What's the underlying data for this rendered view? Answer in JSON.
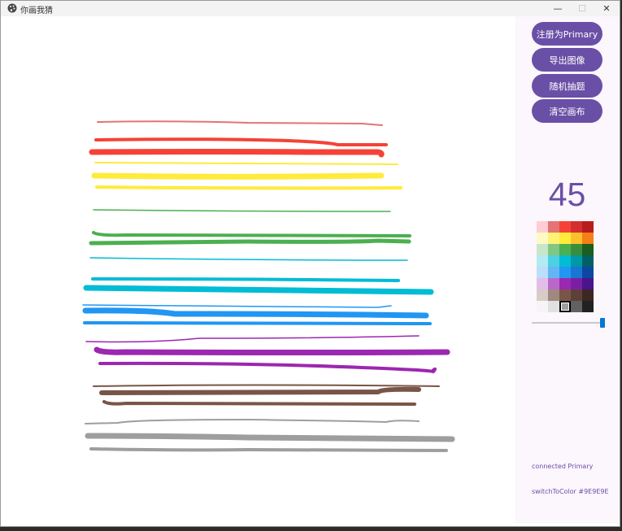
{
  "window": {
    "title": "你画我猜",
    "controls": [
      "—",
      "☐",
      "✕"
    ]
  },
  "actions": [
    {
      "label": "注册为Primary"
    },
    {
      "label": "导出图像"
    },
    {
      "label": "随机抽题"
    },
    {
      "label": "清空画布"
    }
  ],
  "brush": {
    "size": "45",
    "slider_fraction": 1.0,
    "selected_color": "#9E9E9E"
  },
  "palette": [
    [
      "#FFCDD2",
      "#E57373",
      "#F44336",
      "#D32F2F",
      "#B71C1C"
    ],
    [
      "#FFF9C4",
      "#FFF176",
      "#FFEB3B",
      "#FBC02D",
      "#F57F17"
    ],
    [
      "#C8E6C9",
      "#81C784",
      "#4CAF50",
      "#388E3C",
      "#1B5E20"
    ],
    [
      "#B2EBF2",
      "#4DD0E1",
      "#00BCD4",
      "#0097A7",
      "#006064"
    ],
    [
      "#BBDEFB",
      "#64B5F6",
      "#2196F3",
      "#1976D2",
      "#0D47A1"
    ],
    [
      "#E1BEE7",
      "#BA68C8",
      "#9C27B0",
      "#7B1FA2",
      "#4A148C"
    ],
    [
      "#D7CCC8",
      "#A1887F",
      "#795548",
      "#5D4037",
      "#3E2723"
    ],
    [
      "#F5F5F5",
      "#E0E0E0",
      "#9E9E9E",
      "#616161",
      "#212121"
    ]
  ],
  "status": {
    "connection": "connected   Primary",
    "last_event": "switchToColor #9E9E9E"
  },
  "strokes": [
    {
      "color": "#E57373",
      "width": 2
    },
    {
      "color": "#F44336",
      "width": 4
    },
    {
      "color": "#F44336",
      "width": 7
    },
    {
      "color": "#FFEB3B",
      "width": 2
    },
    {
      "color": "#FFEB3B",
      "width": 7
    },
    {
      "color": "#FFEB3B",
      "width": 4
    },
    {
      "color": "#4CAF50",
      "width": 1.5
    },
    {
      "color": "#4CAF50",
      "width": 4
    },
    {
      "color": "#4CAF50",
      "width": 5
    },
    {
      "color": "#00BCD4",
      "width": 1.5
    },
    {
      "color": "#00BCD4",
      "width": 4
    },
    {
      "color": "#00BCD4",
      "width": 7
    },
    {
      "color": "#2196F3",
      "width": 1.5
    },
    {
      "color": "#2196F3",
      "width": 7
    },
    {
      "color": "#2196F3",
      "width": 4
    },
    {
      "color": "#9C27B0",
      "width": 1.5
    },
    {
      "color": "#9C27B0",
      "width": 7
    },
    {
      "color": "#9C27B0",
      "width": 4
    },
    {
      "color": "#795548",
      "width": 2
    },
    {
      "color": "#795548",
      "width": 6
    },
    {
      "color": "#795548",
      "width": 4
    },
    {
      "color": "#9E9E9E",
      "width": 2
    },
    {
      "color": "#9E9E9E",
      "width": 7
    },
    {
      "color": "#9E9E9E",
      "width": 4
    }
  ]
}
